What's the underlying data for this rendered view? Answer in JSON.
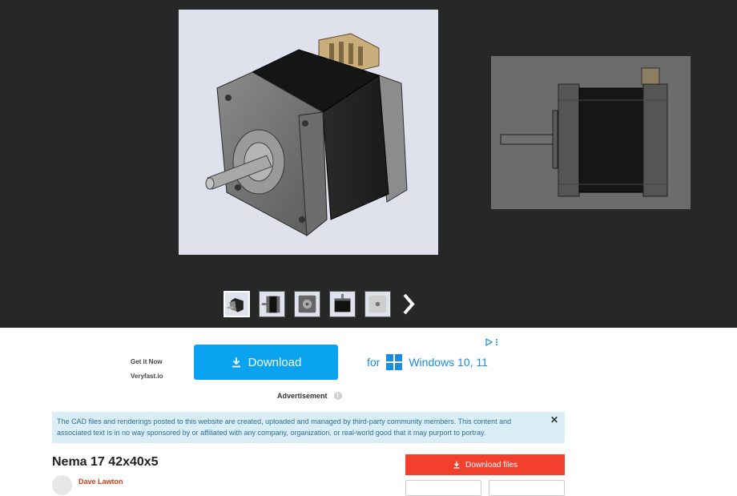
{
  "gallery": {
    "thumbnails": [
      "thumbnail-iso",
      "thumbnail-side",
      "thumbnail-front",
      "thumbnail-top",
      "thumbnail-back"
    ],
    "active_index": 0,
    "next_icon": "chevron-right-icon"
  },
  "ad": {
    "get_it_now": "Get it Now",
    "sponsor": "Veryfast.io",
    "download_label": "Download",
    "for_label": "for",
    "windows_label": "Windows 10, 11",
    "ad_label": "Advertisement",
    "colors": {
      "button": "#0aa3f0",
      "windows": "#1a8de0"
    }
  },
  "notice": {
    "text": "The CAD files and renderings posted to this website are created, uploaded and managed by third-party community members. This content and associated text is in no way sponsored by or affiliated with any company, organization, or real-world good that it may purport to portray.",
    "close_label": "✕"
  },
  "model": {
    "title": "Nema 17 42x40x5",
    "author": "Dave Lawton",
    "download_files_label": "Download files",
    "colors": {
      "download": "#f23f2e",
      "author": "#d9391c"
    }
  }
}
